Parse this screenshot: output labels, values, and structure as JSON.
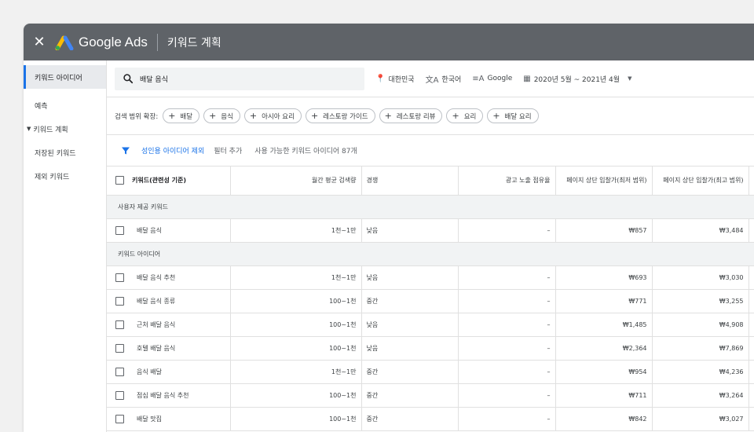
{
  "topbar": {
    "brand": "Google Ads",
    "page_title": "키워드 계획",
    "close_icon": "close-icon"
  },
  "sidebar": {
    "items": [
      {
        "label": "키워드 아이디어",
        "active": true
      },
      {
        "label": "예측"
      },
      {
        "label": "키워드 계획",
        "expandable": true
      },
      {
        "label": "저장된 키워드"
      },
      {
        "label": "제외 키워드"
      }
    ]
  },
  "search": {
    "value": "배달 음식",
    "location": "대한민국",
    "language": "한국어",
    "network": "Google",
    "date_range": "2020년 5월 ~ 2021년 4월"
  },
  "broaden": {
    "label": "검색 범위 확장:",
    "chips": [
      "배달",
      "음식",
      "아시아 요리",
      "레스토랑 가이드",
      "레스토랑 리뷰",
      "요리",
      "배달 요리"
    ]
  },
  "filters": {
    "active_filter": "성인용 아이디어 제외",
    "add_filter": "필터 추가",
    "available": "사용 가능한 키워드 아이디어 87개"
  },
  "table": {
    "headers": {
      "keyword": "키워드(관련성 기준)",
      "monthly_searches": "월간 평균 검색량",
      "competition": "경쟁",
      "impression_share": "광고 노출 점유율",
      "top_bid_low": "페이지 상단 입찰가(최저 범위)",
      "top_bid_high": "페이지 상단 입찰가(최고 범위)"
    },
    "group_provided": "사용자 제공 키워드",
    "provided_rows": [
      {
        "keyword": "배달 음식",
        "searches": "1천~1만",
        "competition": "낮음",
        "share": "–",
        "low": "₩857",
        "high": "₩3,484"
      }
    ],
    "group_ideas": "키워드 아이디어",
    "idea_rows": [
      {
        "keyword": "배달 음식 추천",
        "searches": "1천~1만",
        "competition": "낮음",
        "share": "–",
        "low": "₩693",
        "high": "₩3,030"
      },
      {
        "keyword": "배달 음식 종류",
        "searches": "100~1천",
        "competition": "중간",
        "share": "–",
        "low": "₩771",
        "high": "₩3,255"
      },
      {
        "keyword": "근처 배달 음식",
        "searches": "100~1천",
        "competition": "낮음",
        "share": "–",
        "low": "₩1,485",
        "high": "₩4,908"
      },
      {
        "keyword": "호텔 배달 음식",
        "searches": "100~1천",
        "competition": "낮음",
        "share": "–",
        "low": "₩2,364",
        "high": "₩7,869"
      },
      {
        "keyword": "음식 배달",
        "searches": "1천~1만",
        "competition": "중간",
        "share": "–",
        "low": "₩954",
        "high": "₩4,236"
      },
      {
        "keyword": "점심 배달 음식 추천",
        "searches": "100~1천",
        "competition": "중간",
        "share": "–",
        "low": "₩711",
        "high": "₩3,264"
      },
      {
        "keyword": "배달 맛집",
        "searches": "100~1천",
        "competition": "중간",
        "share": "–",
        "low": "₩842",
        "high": "₩3,027"
      }
    ]
  }
}
